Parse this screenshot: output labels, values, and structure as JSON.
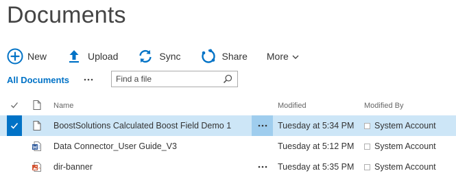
{
  "page": {
    "title": "Documents"
  },
  "toolbar": {
    "new_label": "New",
    "upload_label": "Upload",
    "sync_label": "Sync",
    "share_label": "Share",
    "more_label": "More"
  },
  "view": {
    "current": "All Documents",
    "search_placeholder": "Find a file"
  },
  "table": {
    "columns": {
      "name": "Name",
      "modified": "Modified",
      "modified_by": "Modified By"
    },
    "rows": [
      {
        "name": "BoostSolutions Calculated Boost Field Demo 1",
        "type_icon": "document-icon",
        "modified": "Tuesday at 5:34 PM",
        "modified_by": "System Account",
        "selected": true
      },
      {
        "name": "Data Connector_User Guide_V3",
        "type_icon": "word-doc-icon",
        "modified": "Tuesday at 5:12 PM",
        "modified_by": "System Account",
        "selected": false
      },
      {
        "name": "dir-banner",
        "type_icon": "image-file-icon",
        "modified": "Tuesday at 5:35 PM",
        "modified_by": "System Account",
        "selected": false
      }
    ]
  },
  "colors": {
    "accent": "#0072c6",
    "selected_row": "#cde6f7",
    "selected_ellipsis": "#9fcdee",
    "title": "#444444"
  }
}
